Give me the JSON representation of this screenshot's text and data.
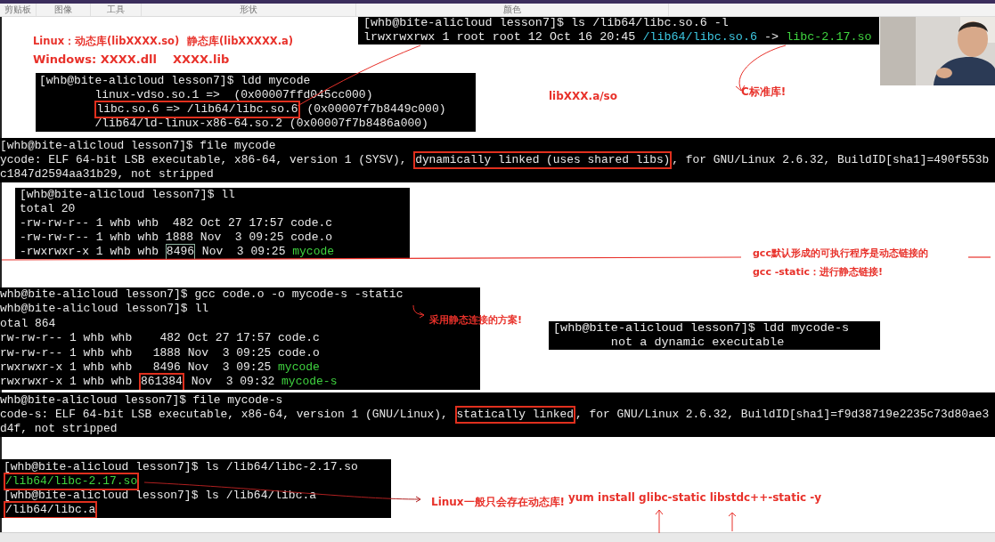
{
  "ribbon": {
    "groups": [
      "剪贴板",
      "图像",
      "工具",
      "形状",
      "颜色"
    ]
  },
  "notes": [
    {
      "text": "Linux：动态库(libXXXX.so)"
    },
    {
      "text": "静态库(libXXXXX.a)"
    },
    {
      "text": "Windows: XXXX.dll"
    },
    {
      "text": "XXXX.lib"
    },
    {
      "text": "libXXX.a/so"
    },
    {
      "text": "C标准库!"
    },
    {
      "text": "gcc默认形成的可执行程序是动态链接的"
    },
    {
      "text": "gcc -static：进行静态链接!"
    },
    {
      "text": "采用静态连接的方案!"
    },
    {
      "text": "Linux一般只会存在动态库!"
    },
    {
      "text": "yum install glibc-static libstdc++-static -y"
    }
  ],
  "terminals": [
    {
      "lines": [
        [
          {
            "text": "[whb@bite-alicloud lesson7]$ ls /lib64/libc.so.6 -l",
            "kind": "plain"
          }
        ],
        [
          {
            "text": "lrwxrwxrwx 1 root root 12 Oct 16 20:45 ",
            "kind": "plain"
          },
          {
            "text": "/lib64/libc.so.6",
            "kind": "symlink"
          },
          {
            "text": " -> ",
            "kind": "plain"
          },
          {
            "text": "libc-2.17.so",
            "kind": "executable"
          }
        ]
      ]
    },
    {
      "lines": [
        [
          {
            "text": "[whb@bite-alicloud lesson7]$ ldd mycode",
            "kind": "plain"
          }
        ],
        [
          {
            "text": "linux-vdso.so.1 =>  (0x00007ffd045cc000)",
            "kind": "plain"
          }
        ],
        [
          {
            "text": "libc.so.6 => /lib64/libc.so.6",
            "kind": "plain",
            "highlighted": true
          },
          {
            "text": " (0x00007f7b8449c000)",
            "kind": "plain"
          }
        ],
        [
          {
            "text": "/lib64/ld-linux-x86-64.so.2 (0x00007f7b8486a000)",
            "kind": "plain"
          }
        ]
      ]
    },
    {
      "lines": [
        [
          {
            "text": "[whb@bite-alicloud lesson7]$ file mycode",
            "kind": "plain"
          }
        ],
        [
          {
            "text": "ycode: ELF 64-bit LSB executable, x86-64, version 1 (SYSV), ",
            "kind": "plain"
          },
          {
            "text": "dynamically linked (uses shared libs)",
            "kind": "plain",
            "highlighted": true
          },
          {
            "text": ", for GNU/Linux 2.6.32, BuildID[sha1]=490f553b",
            "kind": "plain"
          }
        ],
        [
          {
            "text": "c1847d2594aa31b29, not stripped",
            "kind": "plain"
          }
        ]
      ]
    },
    {
      "lines": [
        [
          {
            "text": "[whb@bite-alicloud lesson7]$ ll",
            "kind": "plain"
          }
        ],
        [
          {
            "text": "total 20",
            "kind": "plain"
          }
        ],
        [
          {
            "text": "-rw-rw-r-- 1 whb whb  482 Oct 27 17:57 code.c",
            "kind": "plain"
          }
        ],
        [
          {
            "text": "-rw-rw-r-- 1 whb whb 1888 Nov  3 09:25 code.o",
            "kind": "plain"
          }
        ],
        [
          {
            "text": "-rwxrwxr-x 1 whb whb ",
            "kind": "plain"
          },
          {
            "text": "8496",
            "kind": "plain",
            "outlined": true
          },
          {
            "text": " Nov  3 09:25 ",
            "kind": "plain"
          },
          {
            "text": "mycode",
            "kind": "executable"
          }
        ]
      ]
    },
    {
      "lines": [
        [
          {
            "text": "whb@bite-alicloud lesson7]$ gcc code.o -o mycode-s -static",
            "kind": "plain"
          }
        ],
        [
          {
            "text": "whb@bite-alicloud lesson7]$ ll",
            "kind": "plain"
          }
        ],
        [
          {
            "text": "otal 864",
            "kind": "plain"
          }
        ],
        [
          {
            "text": "rw-rw-r-- 1 whb whb    482 Oct 27 17:57 code.c",
            "kind": "plain"
          }
        ],
        [
          {
            "text": "rw-rw-r-- 1 whb whb   1888 Nov  3 09:25 code.o",
            "kind": "plain"
          }
        ],
        [
          {
            "text": "rwxrwxr-x 1 whb whb   8496 Nov  3 09:25 ",
            "kind": "plain"
          },
          {
            "text": "mycode",
            "kind": "executable"
          }
        ],
        [
          {
            "text": "rwxrwxr-x 1 whb whb ",
            "kind": "plain"
          },
          {
            "text": "861384",
            "kind": "plain",
            "highlighted": true
          },
          {
            "text": " Nov  3 09:32 ",
            "kind": "plain"
          },
          {
            "text": "mycode-s",
            "kind": "executable"
          }
        ]
      ]
    },
    {
      "lines": [
        [
          {
            "text": "[whb@bite-alicloud lesson7]$ ldd mycode-s",
            "kind": "plain"
          }
        ],
        [
          {
            "text": "        not a dynamic executable",
            "kind": "plain"
          }
        ]
      ]
    },
    {
      "lines": [
        [
          {
            "text": "whb@bite-alicloud lesson7]$ file mycode-s",
            "kind": "plain"
          }
        ],
        [
          {
            "text": "code-s: ELF 64-bit LSB executable, x86-64, version 1 (GNU/Linux), ",
            "kind": "plain"
          },
          {
            "text": "statically linked",
            "kind": "plain",
            "highlighted": true
          },
          {
            "text": ", for GNU/Linux 2.6.32, BuildID[sha1]=f9d38719e2235c73d80ae3",
            "kind": "plain"
          }
        ],
        [
          {
            "text": "d4f, not stripped",
            "kind": "plain"
          }
        ]
      ]
    },
    {
      "lines": [
        [
          {
            "text": "[whb@bite-alicloud lesson7]$ ls /lib64/libc-2.17.so",
            "kind": "plain"
          }
        ],
        [
          {
            "text": "/lib64/libc-2.17.so",
            "kind": "executable",
            "highlighted": true
          }
        ],
        [
          {
            "text": "[whb@bite-alicloud lesson7]$ ls /lib64/libc.a",
            "kind": "plain"
          }
        ],
        [
          {
            "text": "/lib64/libc.a",
            "kind": "plain",
            "highlighted": true
          }
        ]
      ]
    }
  ]
}
